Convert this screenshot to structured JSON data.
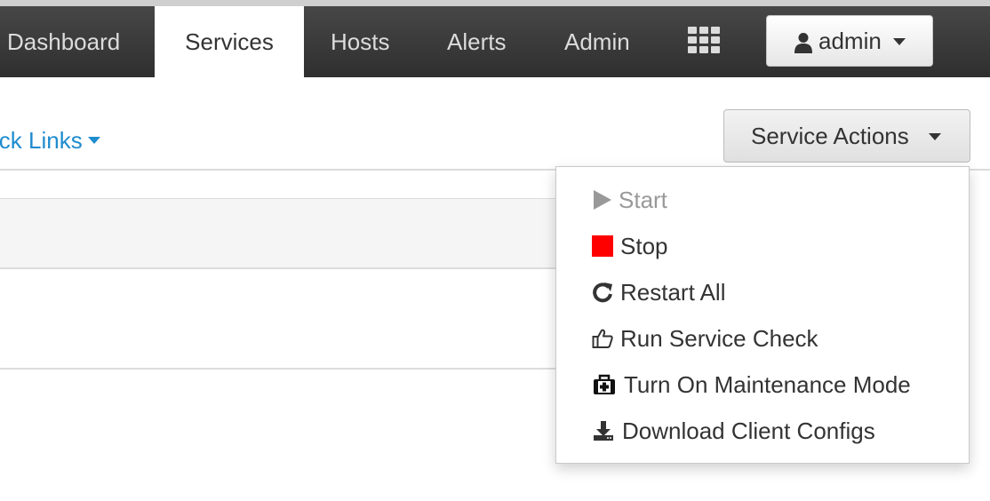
{
  "nav": {
    "items": [
      {
        "label": "Dashboard"
      },
      {
        "label": "Services"
      },
      {
        "label": "Hosts"
      },
      {
        "label": "Alerts"
      },
      {
        "label": "Admin"
      }
    ],
    "active": "Services",
    "apps_icon": "grid-icon",
    "user": {
      "label": "admin",
      "icon": "user-icon"
    }
  },
  "page": {
    "quick_links_label": "ick Links"
  },
  "service_actions": {
    "button_label": "Service Actions",
    "menu": [
      {
        "label": "Start",
        "icon": "play-icon",
        "disabled": true
      },
      {
        "label": "Stop",
        "icon": "stop-icon",
        "color": "#ff0000"
      },
      {
        "label": "Restart All",
        "icon": "refresh-icon"
      },
      {
        "label": "Run Service Check",
        "icon": "thumbs-up-icon"
      },
      {
        "label": "Turn On Maintenance Mode",
        "icon": "medkit-icon"
      },
      {
        "label": "Download Client Configs",
        "icon": "download-icon"
      }
    ]
  },
  "colors": {
    "navbar": "#3a3a3a",
    "link": "#1f8ccf",
    "stop": "#ff0000"
  }
}
